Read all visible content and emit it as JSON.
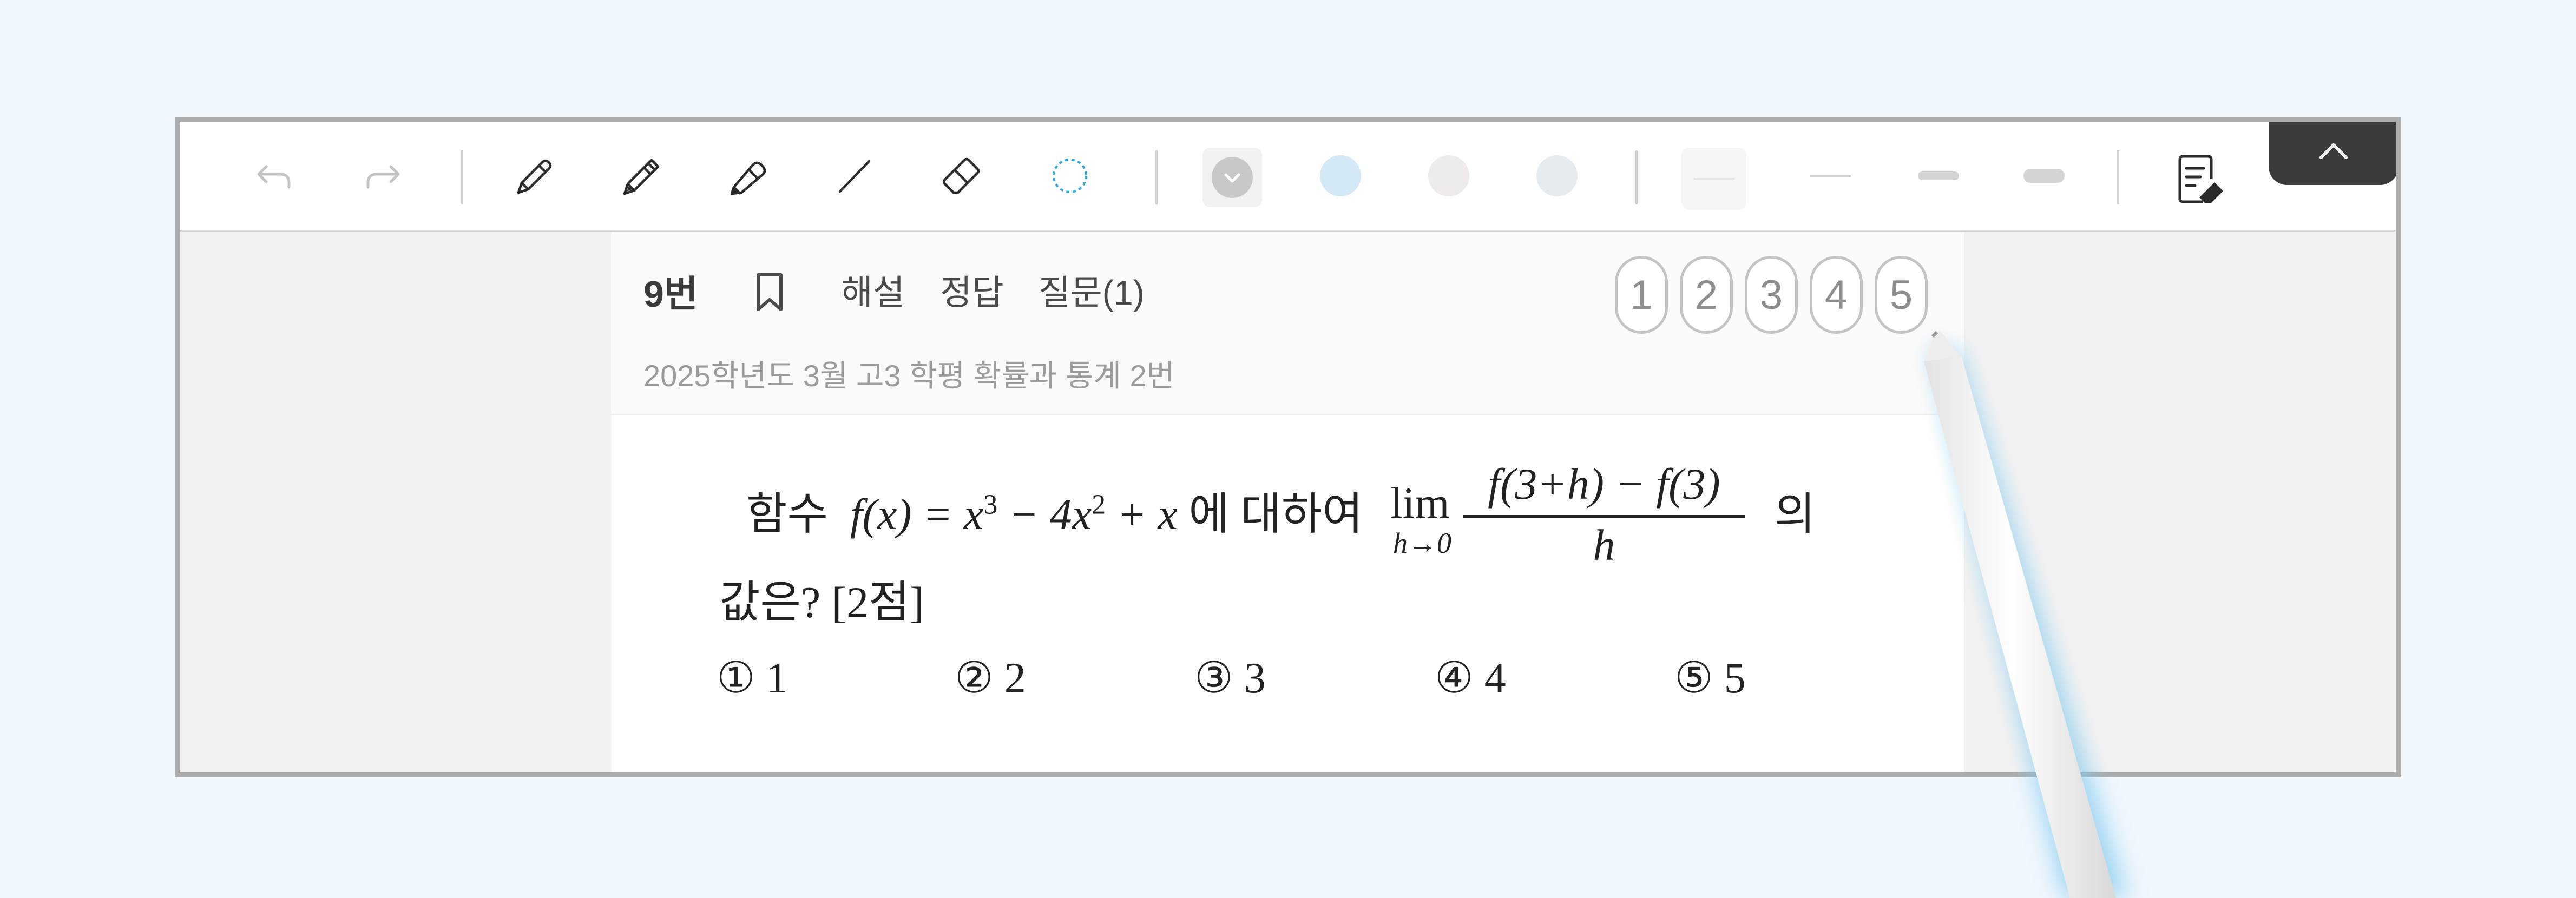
{
  "toolbar": {
    "tools": [
      {
        "name": "undo-icon"
      },
      {
        "name": "redo-icon"
      },
      {
        "name": "pen-icon"
      },
      {
        "name": "fountain-pen-icon"
      },
      {
        "name": "highlighter-icon"
      },
      {
        "name": "line-icon"
      },
      {
        "name": "eraser-icon"
      },
      {
        "name": "lasso-icon"
      }
    ],
    "colors": [
      "#c8c8c8",
      "#d3eaf6",
      "#efebeb",
      "#e6ebef"
    ],
    "accent": "#29a7e0",
    "stroke_widths": [
      "thinnest",
      "thin",
      "medium",
      "thick"
    ]
  },
  "question": {
    "number": "9번",
    "tabs": [
      "해설",
      "정답",
      "질문(1)"
    ],
    "source": "2025학년도 3월 고3 학평 확률과 통계 2번",
    "answer_choices": [
      "1",
      "2",
      "3",
      "4",
      "5"
    ]
  },
  "problem": {
    "intro": "함수",
    "function_lhs": "f(x) = x",
    "exp3": "3",
    "minus": " − 4x",
    "exp2": "2",
    "plus": " + x",
    "about": "에  대하여",
    "lim": "lim",
    "lim_sub": "h→0",
    "numerator": "f(3+h) − f(3)",
    "denominator": "h",
    "suffix": "의",
    "line2": "값은?  [2점]",
    "choices": [
      "① 1",
      "② 2",
      "③ 3",
      "④ 4",
      "⑤ 5"
    ]
  }
}
